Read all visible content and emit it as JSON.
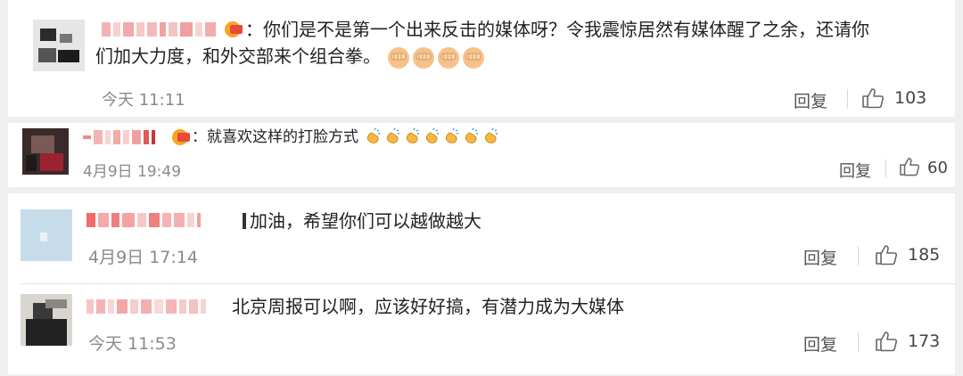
{
  "comments": [
    {
      "text_line1": "：你们是不是第一个出来反击的媒体呀？令我震惊居然有媒体醒了之余，还请你",
      "text_line2": "们加大力度，和外交部来个组合拳。",
      "emoji_count": 4,
      "time": "今天 11:11",
      "reply_label": "回复",
      "likes": "103"
    },
    {
      "text": "：就喜欢这样的打脸方式",
      "emoji_count": 7,
      "time": "4月9日 19:49",
      "reply_label": "回复",
      "likes": "60"
    },
    {
      "text": "加油，希望你们可以越做越大",
      "time": "4月9日 17:14",
      "reply_label": "回复",
      "likes": "185"
    },
    {
      "text": "北京周报可以啊，应该好好搞，有潜力成为大媒体",
      "time": "今天 11:53",
      "reply_label": "回复",
      "likes": "173"
    }
  ],
  "icons": {
    "like": "thumbs-up-icon",
    "fist": "fist-emoji-icon",
    "clap": "clap-emoji-icon"
  },
  "colors": {
    "card_bg": "#ffffff",
    "page_bg": "#efefef",
    "text": "#222222",
    "meta": "#8a8a8a",
    "badge": "#f5a623"
  }
}
